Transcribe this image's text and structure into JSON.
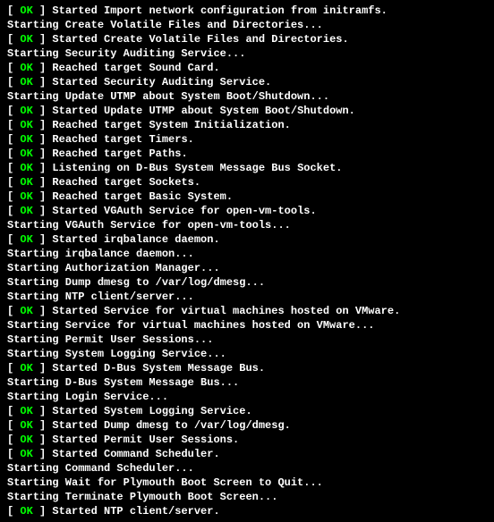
{
  "status_label": "OK",
  "lines": [
    {
      "status": true,
      "text": "Started Import network configuration from initramfs."
    },
    {
      "status": false,
      "text": "Starting Create Volatile Files and Directories..."
    },
    {
      "status": true,
      "text": "Started Create Volatile Files and Directories."
    },
    {
      "status": false,
      "text": "Starting Security Auditing Service..."
    },
    {
      "status": true,
      "text": "Reached target Sound Card."
    },
    {
      "status": true,
      "text": "Started Security Auditing Service."
    },
    {
      "status": false,
      "text": "Starting Update UTMP about System Boot/Shutdown..."
    },
    {
      "status": true,
      "text": "Started Update UTMP about System Boot/Shutdown."
    },
    {
      "status": true,
      "text": "Reached target System Initialization."
    },
    {
      "status": true,
      "text": "Reached target Timers."
    },
    {
      "status": true,
      "text": "Reached target Paths."
    },
    {
      "status": true,
      "text": "Listening on D-Bus System Message Bus Socket."
    },
    {
      "status": true,
      "text": "Reached target Sockets."
    },
    {
      "status": true,
      "text": "Reached target Basic System."
    },
    {
      "status": true,
      "text": "Started VGAuth Service for open-vm-tools."
    },
    {
      "status": false,
      "text": "Starting VGAuth Service for open-vm-tools..."
    },
    {
      "status": true,
      "text": "Started irqbalance daemon."
    },
    {
      "status": false,
      "text": "Starting irqbalance daemon..."
    },
    {
      "status": false,
      "text": "Starting Authorization Manager..."
    },
    {
      "status": false,
      "text": "Starting Dump dmesg to /var/log/dmesg..."
    },
    {
      "status": false,
      "text": "Starting NTP client/server..."
    },
    {
      "status": true,
      "text": "Started Service for virtual machines hosted on VMware."
    },
    {
      "status": false,
      "text": "Starting Service for virtual machines hosted on VMware..."
    },
    {
      "status": false,
      "text": "Starting Permit User Sessions..."
    },
    {
      "status": false,
      "text": "Starting System Logging Service..."
    },
    {
      "status": true,
      "text": "Started D-Bus System Message Bus."
    },
    {
      "status": false,
      "text": "Starting D-Bus System Message Bus..."
    },
    {
      "status": false,
      "text": "Starting Login Service..."
    },
    {
      "status": true,
      "text": "Started System Logging Service."
    },
    {
      "status": true,
      "text": "Started Dump dmesg to /var/log/dmesg."
    },
    {
      "status": true,
      "text": "Started Permit User Sessions."
    },
    {
      "status": true,
      "text": "Started Command Scheduler."
    },
    {
      "status": false,
      "text": "Starting Command Scheduler..."
    },
    {
      "status": false,
      "text": "Starting Wait for Plymouth Boot Screen to Quit..."
    },
    {
      "status": false,
      "text": "Starting Terminate Plymouth Boot Screen..."
    },
    {
      "status": true,
      "text": "Started NTP client/server."
    }
  ]
}
